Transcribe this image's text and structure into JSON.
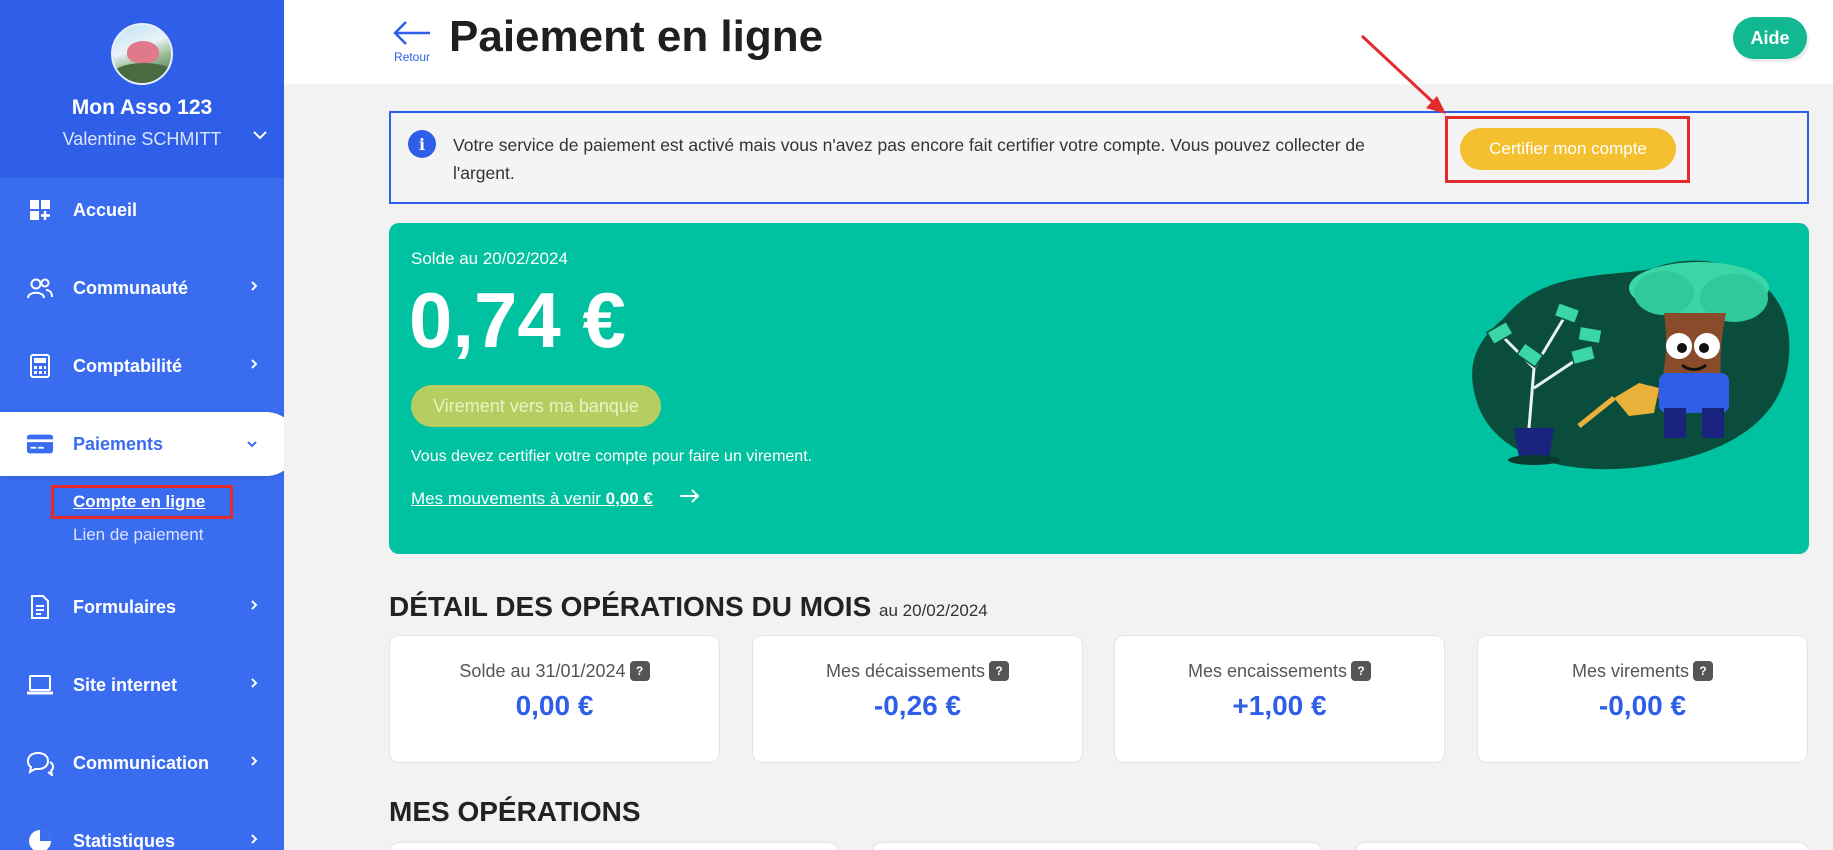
{
  "sidebar": {
    "org_name": "Mon Asso 123",
    "user_name": "Valentine SCHMITT",
    "items": [
      {
        "label": "Accueil"
      },
      {
        "label": "Communauté"
      },
      {
        "label": "Comptabilité"
      },
      {
        "label": "Paiements"
      },
      {
        "label": "Formulaires"
      },
      {
        "label": "Site internet"
      },
      {
        "label": "Communication"
      },
      {
        "label": "Statistiques"
      }
    ],
    "sub_items": [
      {
        "label": "Compte en ligne"
      },
      {
        "label": "Lien de paiement"
      }
    ]
  },
  "header": {
    "back_label": "Retour",
    "title": "Paiement en ligne",
    "help_label": "Aide"
  },
  "alert": {
    "text": "Votre service de paiement est activé mais vous n'avez pas encore fait certifier votre compte. Vous pouvez collecter de l'argent.",
    "button": "Certifier mon compte"
  },
  "balance": {
    "label": "Solde au 20/02/2024",
    "amount": "0,74 €",
    "transfer_button": "Virement vers ma banque",
    "note": "Vous devez certifier votre compte pour faire un virement.",
    "upcoming_label": "Mes mouvements à venir",
    "upcoming_amount": "0,00 €"
  },
  "detail": {
    "title": "DÉTAIL DES OPÉRATIONS DU MOIS",
    "subtitle": "au 20/02/2024",
    "cards": [
      {
        "label": "Solde au 31/01/2024",
        "value": "0,00 €"
      },
      {
        "label": "Mes décaissements",
        "value": "-0,26 €"
      },
      {
        "label": "Mes encaissements",
        "value": "+1,00 €"
      },
      {
        "label": "Mes virements",
        "value": "-0,00 €"
      }
    ],
    "help_glyph": "?"
  },
  "operations": {
    "title": "MES OPÉRATIONS"
  },
  "colors": {
    "primary": "#3a6cf0",
    "accent_green": "#00c1a0",
    "help_green": "#12b892",
    "certify_yellow": "#f5c030",
    "annotation_red": "#e32b2b"
  }
}
